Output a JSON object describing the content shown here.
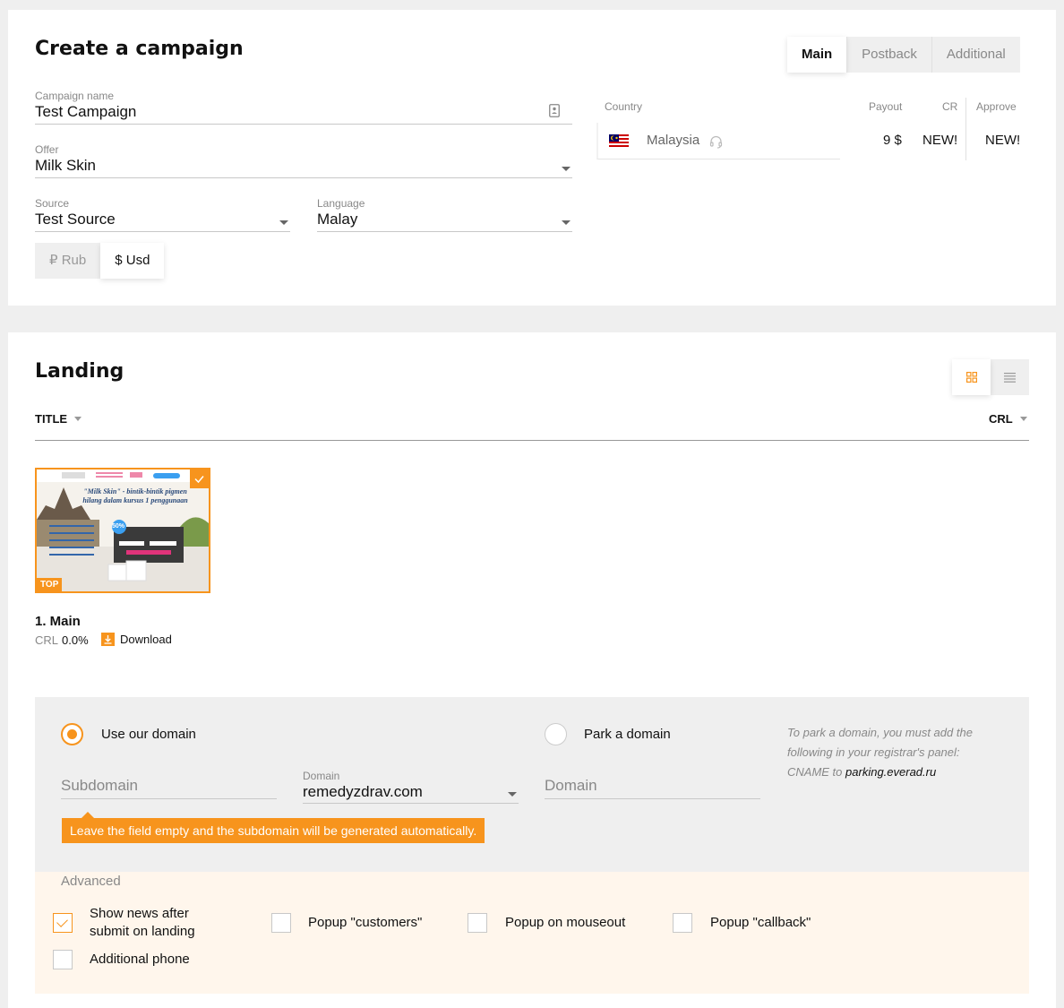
{
  "campaign": {
    "title": "Create a campaign",
    "tabs": [
      {
        "label": "Main",
        "active": true
      },
      {
        "label": "Postback",
        "active": false
      },
      {
        "label": "Additional",
        "active": false
      }
    ],
    "name_label": "Campaign name",
    "name_value": "Test Campaign",
    "offer_label": "Offer",
    "offer_value": "Milk Skin",
    "source_label": "Source",
    "source_value": "Test Source",
    "language_label": "Language",
    "language_value": "Malay",
    "currency": [
      {
        "label": "₽ Rub",
        "active": false
      },
      {
        "label": "$ Usd",
        "active": true
      }
    ],
    "table": {
      "country_header": "Country",
      "payout_header": "Payout",
      "cr_header": "CR",
      "approve_header": "Approve",
      "country": "Malaysia",
      "payout": "9 $",
      "cr": "NEW!",
      "approve": "NEW!"
    }
  },
  "landing": {
    "title": "Landing",
    "col_title": "TITLE",
    "col_crl": "CRL",
    "item": {
      "name": "1. Main",
      "crl_label": "CRL",
      "crl_value": "0.0%",
      "download_label": "Download",
      "top_badge": "TOP",
      "thumb_headline": "\"Milk Skin\" - bintik-bintik pigmen hilang dalam kursus 1 penggunaan",
      "thumb_discount": "50%"
    }
  },
  "domain": {
    "use_label": "Use our domain",
    "park_label": "Park a domain",
    "subdomain_placeholder": "Subdomain",
    "domain_label": "Domain",
    "domain_value": "remedyzdrav.com",
    "park_placeholder": "Domain",
    "tooltip": "Leave the field empty and the subdomain will be generated automatically.",
    "note_line1": "To park a domain, you must add the",
    "note_line2": "following in your registrar's panel:",
    "note_prefix": "CNAME to",
    "note_host": "parking.everad.ru"
  },
  "advanced": {
    "title": "Advanced",
    "options": {
      "show_news_line1": "Show news after",
      "show_news_line2": "submit on landing",
      "popup_customers": "Popup \"customers\"",
      "popup_mouseout": "Popup on mouseout",
      "popup_callback": "Popup \"callback\"",
      "additional_phone": "Additional phone"
    }
  },
  "colors": {
    "accent": "#f7941d",
    "background": "#efefef"
  }
}
